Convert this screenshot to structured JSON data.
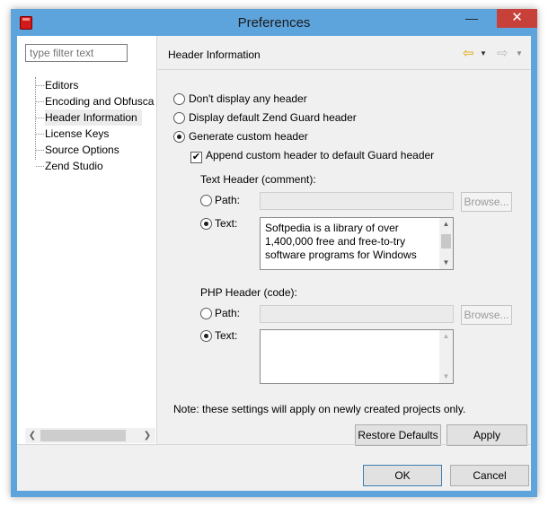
{
  "window": {
    "title": "Preferences",
    "minimize_glyph": "—",
    "maximize_glyph": "☐",
    "close_glyph": "✕"
  },
  "sidebar": {
    "filter_placeholder": "type filter text",
    "items": [
      {
        "label": "Editors"
      },
      {
        "label": "Encoding and Obfusca"
      },
      {
        "label": "Header Information"
      },
      {
        "label": "License Keys"
      },
      {
        "label": "Source Options"
      },
      {
        "label": "Zend Studio"
      }
    ],
    "selected_index": 2
  },
  "page": {
    "title": "Header Information",
    "nav_icons": [
      "back-arrow-icon",
      "back-menu-icon",
      "forward-arrow-icon",
      "forward-menu-icon"
    ],
    "header_options": [
      {
        "label": "Don't display any header",
        "checked": false
      },
      {
        "label": "Display default Zend Guard header",
        "checked": false
      },
      {
        "label": "Generate custom header",
        "checked": true
      }
    ],
    "append_checkbox": {
      "label": "Append custom header to default Guard header",
      "checked": true
    },
    "text_header": {
      "section_label": "Text Header (comment):",
      "path_label": "Path:",
      "path_value": "",
      "browse_label": "Browse...",
      "text_label": "Text:",
      "path_selected": false,
      "text_selected": true,
      "text_lines": [
        "Softpedia is a library of over",
        "1,400,000 free and free-to-try",
        "software programs for Windows"
      ]
    },
    "php_header": {
      "section_label": "PHP Header (code):",
      "path_label": "Path:",
      "path_value": "",
      "browse_label": "Browse...",
      "text_label": "Text:",
      "path_selected": false,
      "text_selected": true,
      "text_value": ""
    },
    "note": "Note: these settings will apply on newly created projects only.",
    "restore_defaults_label": "Restore Defaults",
    "apply_label": "Apply"
  },
  "dialog_buttons": {
    "ok_label": "OK",
    "cancel_label": "Cancel"
  },
  "colors": {
    "frame": "#5ea4dc",
    "close_button": "#c7413a",
    "dialog_background": "#f0f0f0"
  }
}
